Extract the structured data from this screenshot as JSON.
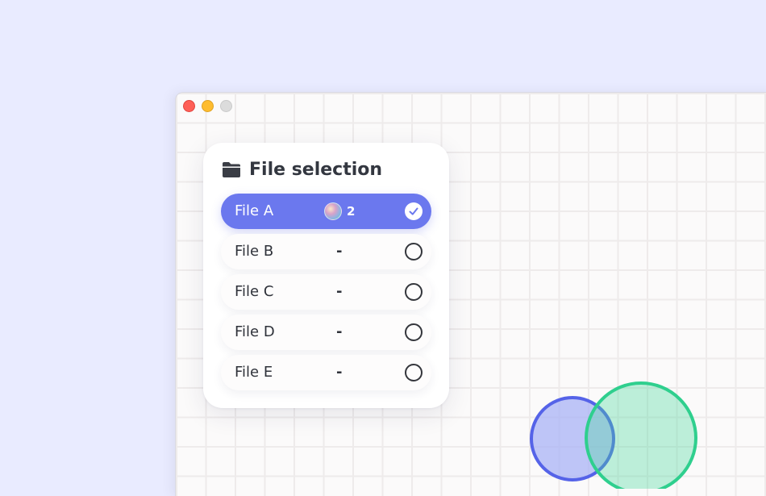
{
  "window": {
    "controls": [
      "close",
      "minimize",
      "zoom"
    ]
  },
  "panel": {
    "title": "File selection",
    "icon": "folder-icon"
  },
  "files": [
    {
      "name": "File A",
      "count": "2",
      "selected": true
    },
    {
      "name": "File B",
      "count": "-",
      "selected": false
    },
    {
      "name": "File C",
      "count": "-",
      "selected": false
    },
    {
      "name": "File D",
      "count": "-",
      "selected": false
    },
    {
      "name": "File E",
      "count": "-",
      "selected": false
    }
  ],
  "colors": {
    "background": "#e9ebff",
    "accent": "#6b78ee",
    "venn_blue": "#5563e8",
    "venn_green": "#2fcf8e"
  }
}
